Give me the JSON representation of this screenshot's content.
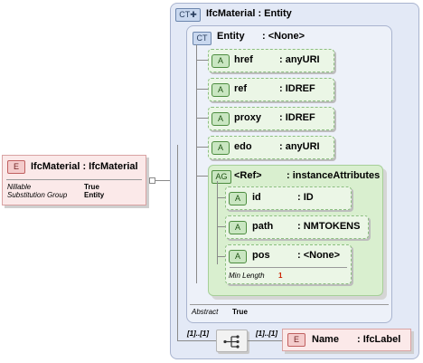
{
  "root_element": {
    "badge": "E",
    "title": "IfcMaterial : IfcMaterial",
    "props": [
      {
        "label": "Nillable",
        "value": "True"
      },
      {
        "label": "Substitution Group",
        "value": "Entity"
      }
    ]
  },
  "complex_type": {
    "badge": "CT",
    "title": "IfcMaterial : Entity",
    "base": {
      "badge": "CT",
      "name": "Entity",
      "type": ": <None>",
      "attributes": [
        {
          "badge": "A",
          "name": "href",
          "type": ": anyURI"
        },
        {
          "badge": "A",
          "name": "ref",
          "type": ": IDREF"
        },
        {
          "badge": "A",
          "name": "proxy",
          "type": ": IDREF"
        },
        {
          "badge": "A",
          "name": "edo",
          "type": ": anyURI"
        }
      ],
      "attribute_group": {
        "badge": "AG",
        "name": "<Ref>",
        "type": ": instanceAttributes",
        "attributes": [
          {
            "badge": "A",
            "name": "id",
            "type": ": ID"
          },
          {
            "badge": "A",
            "name": "path",
            "type": ": NMTOKENS"
          },
          {
            "badge": "A",
            "name": "pos",
            "type": ": <None>",
            "prop_label": "Min Length",
            "prop_value": "1"
          }
        ]
      },
      "abstract_label": "Abstract",
      "abstract_value": "True"
    },
    "sequence": {
      "left_multiplicity": "[1]..[1]",
      "right_multiplicity": "[1]..[1]"
    },
    "child_element": {
      "badge": "E",
      "name": "Name",
      "type": ": IfcLabel"
    }
  },
  "colors": {
    "element_fill": "#fbe9e9",
    "complex_type_fill": "#e3e9f6",
    "attribute_fill": "#ebf6e6",
    "attribute_group_fill": "#d9efcf",
    "min_length_value": "#cc2200"
  }
}
